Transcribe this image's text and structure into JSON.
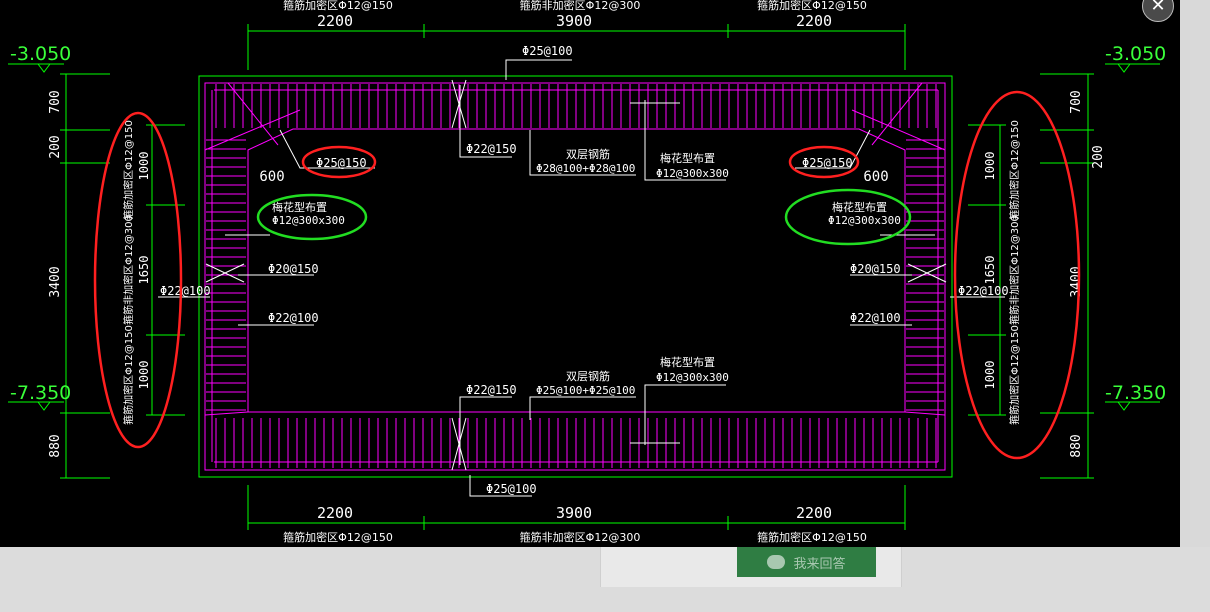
{
  "drawing": {
    "top_dims": [
      "2200",
      "3900",
      "2200"
    ],
    "bottom_dims": [
      "2200",
      "3900",
      "2200"
    ],
    "top_notes": [
      "箍筋加密区Φ12@150",
      "箍筋非加密区Φ12@300",
      "箍筋加密区Φ12@150"
    ],
    "bottom_notes": [
      "箍筋加密区Φ12@150",
      "箍筋非加密区Φ12@300",
      "箍筋加密区Φ12@150"
    ],
    "top_bar": "Φ25@100",
    "bottom_bar": "Φ25@100",
    "top_stirrup": "Φ22@150",
    "bottom_stirrup": "Φ22@150",
    "double_rebar": "双层钢筋",
    "top_double_value": "Φ28@100+Φ28@100",
    "bottom_double_value": "Φ25@100+Φ25@100",
    "plum": "梅花型布置",
    "plum_value": "Φ12@300x300",
    "corner_bar": "Φ25@150",
    "corner_dim": "600",
    "wall_bar_inner": "Φ20@150",
    "wall_bar_inner2": "Φ22@100",
    "wall_bar_outer": "Φ22@100",
    "left_dims": [
      "700",
      "200",
      "3400",
      "880"
    ],
    "right_dims": [
      "700",
      "200",
      "3400",
      "880"
    ],
    "side_sub_dims": [
      "1000",
      "1650",
      "1000"
    ],
    "side_notes": [
      "箍筋加密区Φ12@150",
      "箍筋非加密区Φ12@300",
      "箍筋加密区Φ12@150"
    ],
    "level_top": "-3.050",
    "level_bottom": "-7.350"
  },
  "ui": {
    "close_glyph": "✕",
    "answer_label": "我来回答",
    "answer_icon": "chat-bubble-icon"
  },
  "colors": {
    "background": "#000000",
    "dim_lines": "#00ff00",
    "rebar": "#ff00ff",
    "annotation": "#ffffff",
    "highlight_red": "#ff2020",
    "highlight_green": "#22dd22",
    "button": "#2f7d43"
  }
}
